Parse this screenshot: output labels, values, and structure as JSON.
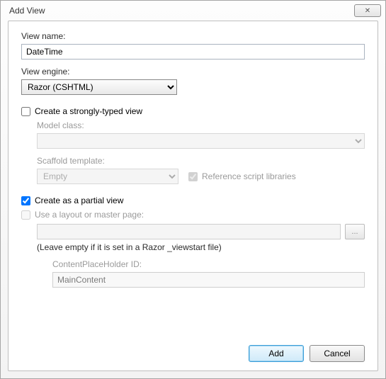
{
  "window": {
    "title": "Add View",
    "close_glyph": "✕"
  },
  "viewName": {
    "label": "View name:",
    "value": "DateTime"
  },
  "viewEngine": {
    "label": "View engine:",
    "value": "Razor (CSHTML)"
  },
  "stronglyTyped": {
    "label": "Create a strongly-typed view",
    "checked": false,
    "modelClass": {
      "label": "Model class:",
      "value": ""
    },
    "scaffold": {
      "label": "Scaffold template:",
      "value": "Empty"
    },
    "refScript": {
      "label": "Reference script libraries",
      "checked": true
    }
  },
  "partialView": {
    "label": "Create as a partial view",
    "checked": true
  },
  "layout": {
    "label": "Use a layout or master page:",
    "checked": false,
    "value": "",
    "browse": "...",
    "help": "(Leave empty if it is set in a Razor _viewstart file)",
    "contentPh": {
      "label": "ContentPlaceHolder ID:",
      "value": "MainContent"
    }
  },
  "buttons": {
    "add": "Add",
    "cancel": "Cancel"
  }
}
